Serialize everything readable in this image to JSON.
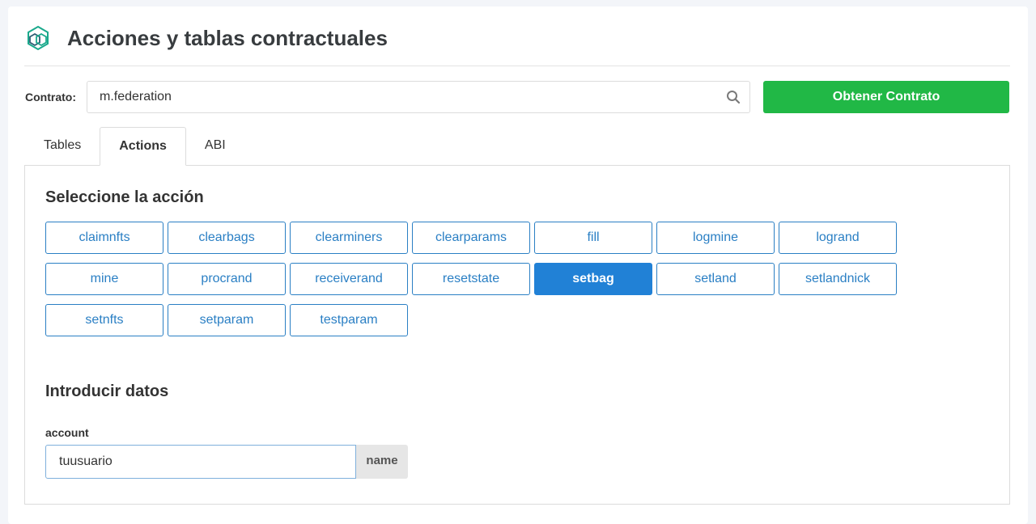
{
  "header": {
    "title": "Acciones y tablas contractuales",
    "logo_icon": "hexagon-logo-icon",
    "accent_color": "#1aa98c"
  },
  "contract": {
    "label": "Contrato:",
    "value": "m.federation",
    "search_icon": "search-icon",
    "fetch_label": "Obtener Contrato",
    "fetch_color": "#21b846"
  },
  "tabs": [
    {
      "label": "Tables",
      "active": false
    },
    {
      "label": "Actions",
      "active": true
    },
    {
      "label": "ABI",
      "active": false
    }
  ],
  "actions_section": {
    "title": "Seleccione la acción",
    "selected": "setbag",
    "accent_color": "#2181d6",
    "items": [
      "claimnfts",
      "clearbags",
      "clearminers",
      "clearparams",
      "fill",
      "logmine",
      "logrand",
      "mine",
      "procrand",
      "receiverand",
      "resetstate",
      "setbag",
      "setland",
      "setlandnick",
      "setnfts",
      "setparam",
      "testparam"
    ]
  },
  "input_section": {
    "title": "Introducir datos",
    "fields": [
      {
        "label": "account",
        "value": "tuusuario",
        "type": "name"
      }
    ]
  }
}
